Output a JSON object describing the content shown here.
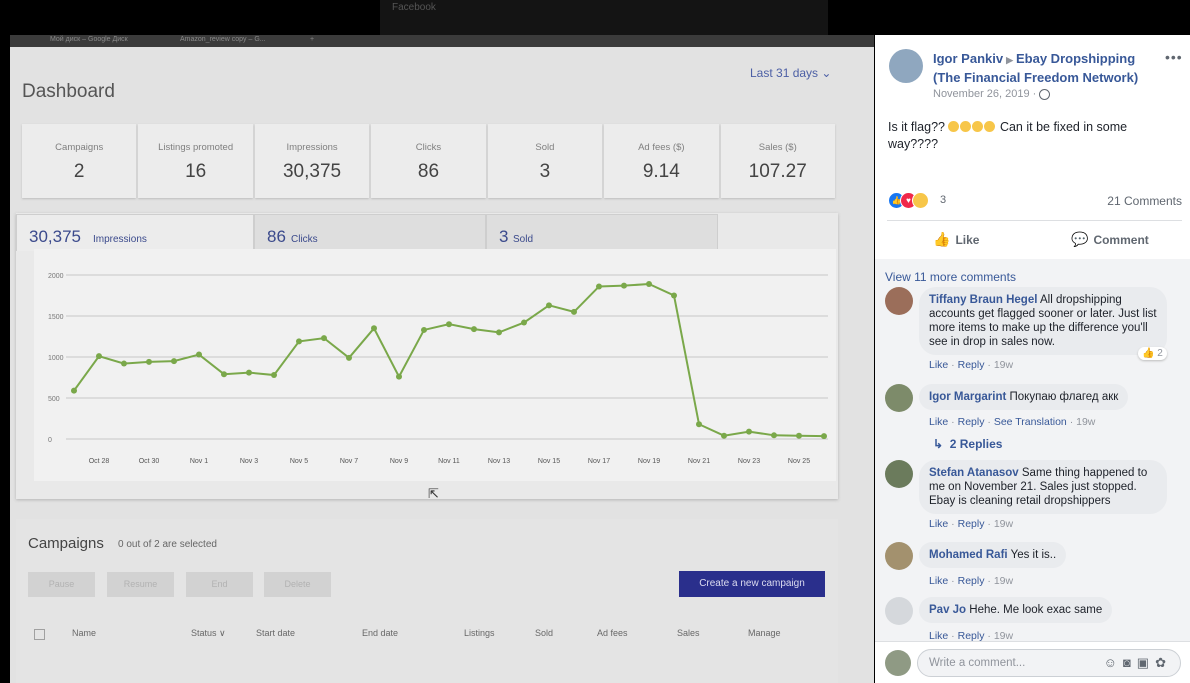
{
  "browser_tabs": [
    "Мой диск – Google Диск",
    "Amazon_review copy – G...",
    "+"
  ],
  "topbar": {
    "text": "Facebook"
  },
  "dashboard": {
    "title": "Dashboard",
    "range": "Last 31 days",
    "stats": [
      {
        "label": "Campaigns",
        "value": "2"
      },
      {
        "label": "Listings promoted",
        "value": "16"
      },
      {
        "label": "Impressions",
        "value": "30,375"
      },
      {
        "label": "Clicks",
        "value": "86"
      },
      {
        "label": "Sold",
        "value": "3"
      },
      {
        "label": "Ad fees ($)",
        "value": "9.14"
      },
      {
        "label": "Sales ($)",
        "value": "107.27"
      }
    ],
    "tabs": [
      {
        "num": "30,375",
        "unit": "Impressions"
      },
      {
        "num": "86",
        "unit": "Clicks"
      },
      {
        "num": "3",
        "unit": "Sold"
      }
    ]
  },
  "chart_data": {
    "type": "line",
    "title": "",
    "xlabel": "",
    "ylabel": "",
    "color": "#7aa84a",
    "ylim": [
      0,
      2000
    ],
    "yticks": [
      0,
      500,
      1000,
      1500,
      2000
    ],
    "x_tick_labels": [
      "Oct 28",
      "Oct 30",
      "Nov 1",
      "Nov 3",
      "Nov 5",
      "Nov 7",
      "Nov 9",
      "Nov 11",
      "Nov 13",
      "Nov 15",
      "Nov 17",
      "Nov 19",
      "Nov 21",
      "Nov 23",
      "Nov 25"
    ],
    "x": [
      "Oct 27",
      "Oct 28",
      "Oct 29",
      "Oct 30",
      "Oct 31",
      "Nov 1",
      "Nov 2",
      "Nov 3",
      "Nov 4",
      "Nov 5",
      "Nov 6",
      "Nov 7",
      "Nov 8",
      "Nov 9",
      "Nov 10",
      "Nov 11",
      "Nov 12",
      "Nov 13",
      "Nov 14",
      "Nov 15",
      "Nov 16",
      "Nov 17",
      "Nov 18",
      "Nov 19",
      "Nov 20",
      "Nov 21",
      "Nov 22",
      "Nov 23",
      "Nov 24",
      "Nov 25",
      "Nov 26"
    ],
    "series": [
      {
        "values": [
          590,
          1010,
          920,
          940,
          950,
          1030,
          790,
          810,
          780,
          1190,
          1230,
          990,
          1350,
          760,
          1330,
          1400,
          1340,
          1300,
          1420,
          1630,
          1550,
          1860,
          1870,
          1890,
          1750,
          180,
          40,
          90,
          45,
          40,
          35
        ]
      }
    ]
  },
  "campaigns": {
    "title": "Campaigns",
    "selected": "0 out of 2 are selected",
    "buttons": [
      "Pause",
      "Resume",
      "End",
      "Delete"
    ],
    "create": "Create a new campaign",
    "columns": [
      "Name",
      "Status ∨",
      "Start date",
      "End date",
      "Listings",
      "Sold",
      "Ad fees",
      "Sales",
      "Manage"
    ]
  },
  "post": {
    "author": "Igor Pankiv",
    "group": "Ebay Dropshipping (The Financial Freedom Network)",
    "date": "November 26, 2019",
    "text": "Is it flag??",
    "text2": "Can it be fixed in some way????",
    "reaction_count": "3",
    "comments_count": "21 Comments",
    "like_label": "Like",
    "comment_label": "Comment",
    "view_more": "View 11 more comments",
    "comments": [
      {
        "name": "Tiffany Braun Hegel",
        "text": "All dropshipping accounts get flagged sooner or later. Just list more items to make up the difference you'll see in drop in sales now.",
        "like": "Like",
        "reply": "Reply",
        "time": "19w",
        "reactions": "2"
      },
      {
        "name": "Igor Margarint",
        "text": "Покупаю флагед акк",
        "like": "Like",
        "reply": "Reply",
        "translate": "See Translation",
        "time": "19w"
      },
      {
        "name": "Stefan Atanasov",
        "text": "Same thing happened to me on November 21. Sales just stopped. Ebay is cleaning retail dropshippers",
        "like": "Like",
        "reply": "Reply",
        "time": "19w"
      },
      {
        "name": "Mohamed Rafi",
        "text": "Yes it is..",
        "like": "Like",
        "reply": "Reply",
        "time": "19w"
      },
      {
        "name": "Pav Jo",
        "text": "Hehe. Me look exac same",
        "like": "Like",
        "reply": "Reply",
        "time": "19w"
      }
    ],
    "replies": "2 Replies",
    "write_placeholder": "Write a comment..."
  }
}
